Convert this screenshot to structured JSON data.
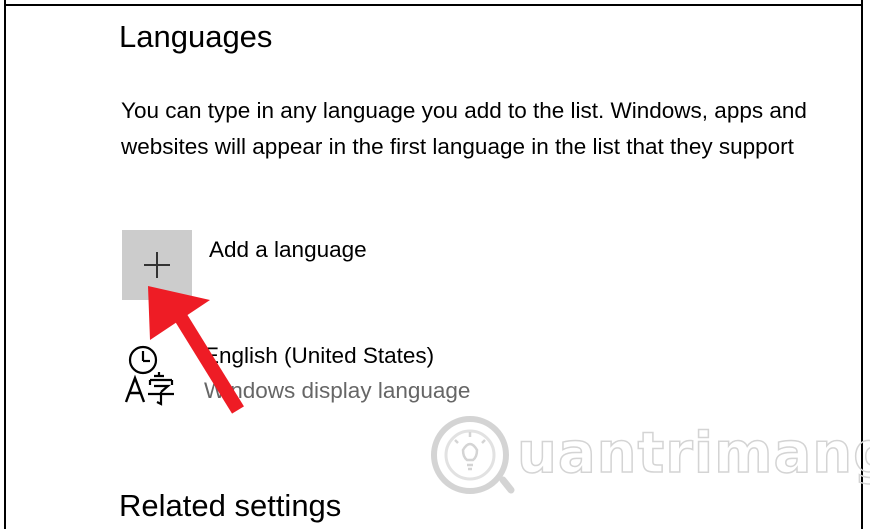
{
  "section": {
    "title": "Languages",
    "description": "You can type in any language you add to the list. Windows, apps and websites will appear in the first language in the list that they support"
  },
  "add_language": {
    "label": "Add a language",
    "icon": "plus-icon",
    "tile_color": "#cccccc"
  },
  "languages": [
    {
      "name": "English (United States)",
      "subtitle": "Windows display language",
      "icon": "language-time-icon"
    }
  ],
  "related": {
    "title": "Related settings"
  },
  "annotation": {
    "arrow_color": "#ee1c25"
  },
  "watermark": {
    "text": "uantrimang",
    "icon": "lightbulb-icon"
  }
}
